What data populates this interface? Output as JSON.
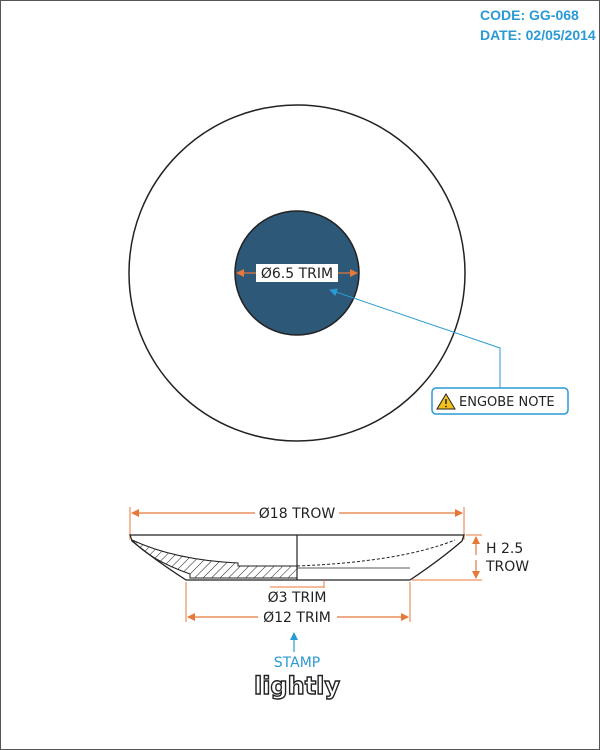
{
  "header": {
    "code": "CODE: GG-068",
    "date": "DATE: 02/05/2014"
  },
  "top_view": {
    "inner_label": "Ø6.5 TRIM",
    "note_label": "ENGOBE NOTE",
    "note_icon": "warning-icon",
    "colors": {
      "inner_fill": "#2e5878",
      "dimension": "#e8773a",
      "leader": "#2a9ad4",
      "outline": "#222222"
    }
  },
  "side_view": {
    "top_dim": "Ø18 TROW",
    "height_dim_line1": "H 2.5",
    "height_dim_line2": "TROW",
    "foot_dim": "Ø3 TRIM",
    "base_dim": "Ø12 TRIM"
  },
  "footer": {
    "stamp_label": "STAMP",
    "brand": "lightly"
  }
}
